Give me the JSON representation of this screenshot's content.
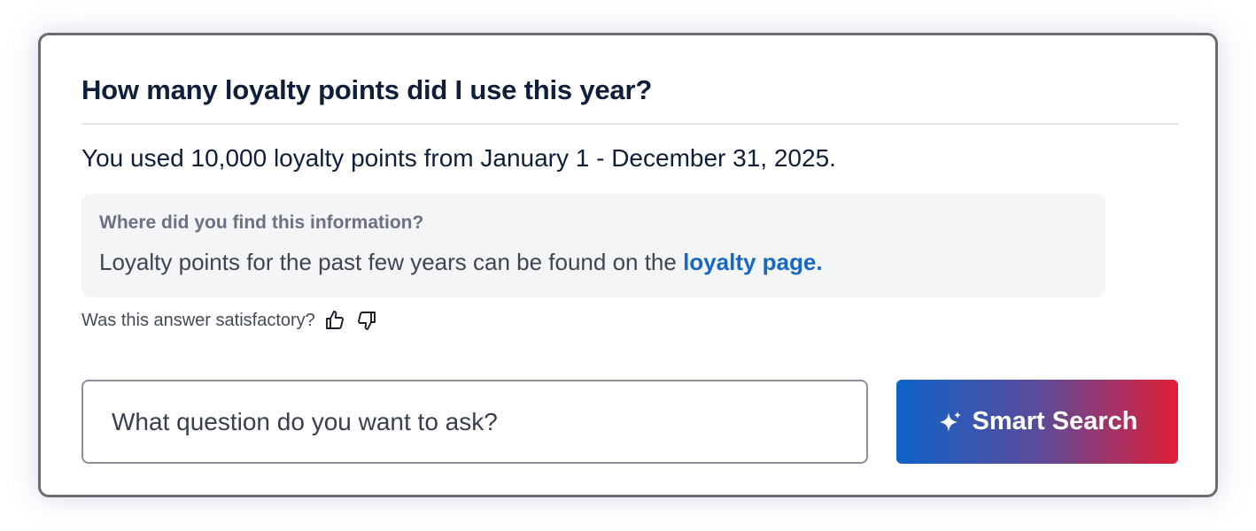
{
  "card": {
    "question": "How many loyalty points did I use this year?",
    "answer": "You used 10,000 loyalty points from January 1 - December 31, 2025.",
    "source": {
      "heading": "Where did you find this information?",
      "text_prefix": "Loyalty points for the past few years can be found on the ",
      "link_label": "loyalty page."
    },
    "feedback": {
      "prompt": "Was this answer satisfactory?",
      "thumbs_up_icon": "thumbs-up-icon",
      "thumbs_down_icon": "thumbs-down-icon"
    },
    "search": {
      "placeholder": "What question do you want to ask?",
      "value": ""
    },
    "smart_search": {
      "label": "Smart Search",
      "icon": "sparkle-icon",
      "gradient": [
        "#0e63c8",
        "#5a4b9b",
        "#e01e37"
      ]
    }
  },
  "colors": {
    "heading": "#0f1f3a",
    "link": "#1668c4",
    "source_bg": "#f4f5f7",
    "border": "#6b6b70"
  }
}
